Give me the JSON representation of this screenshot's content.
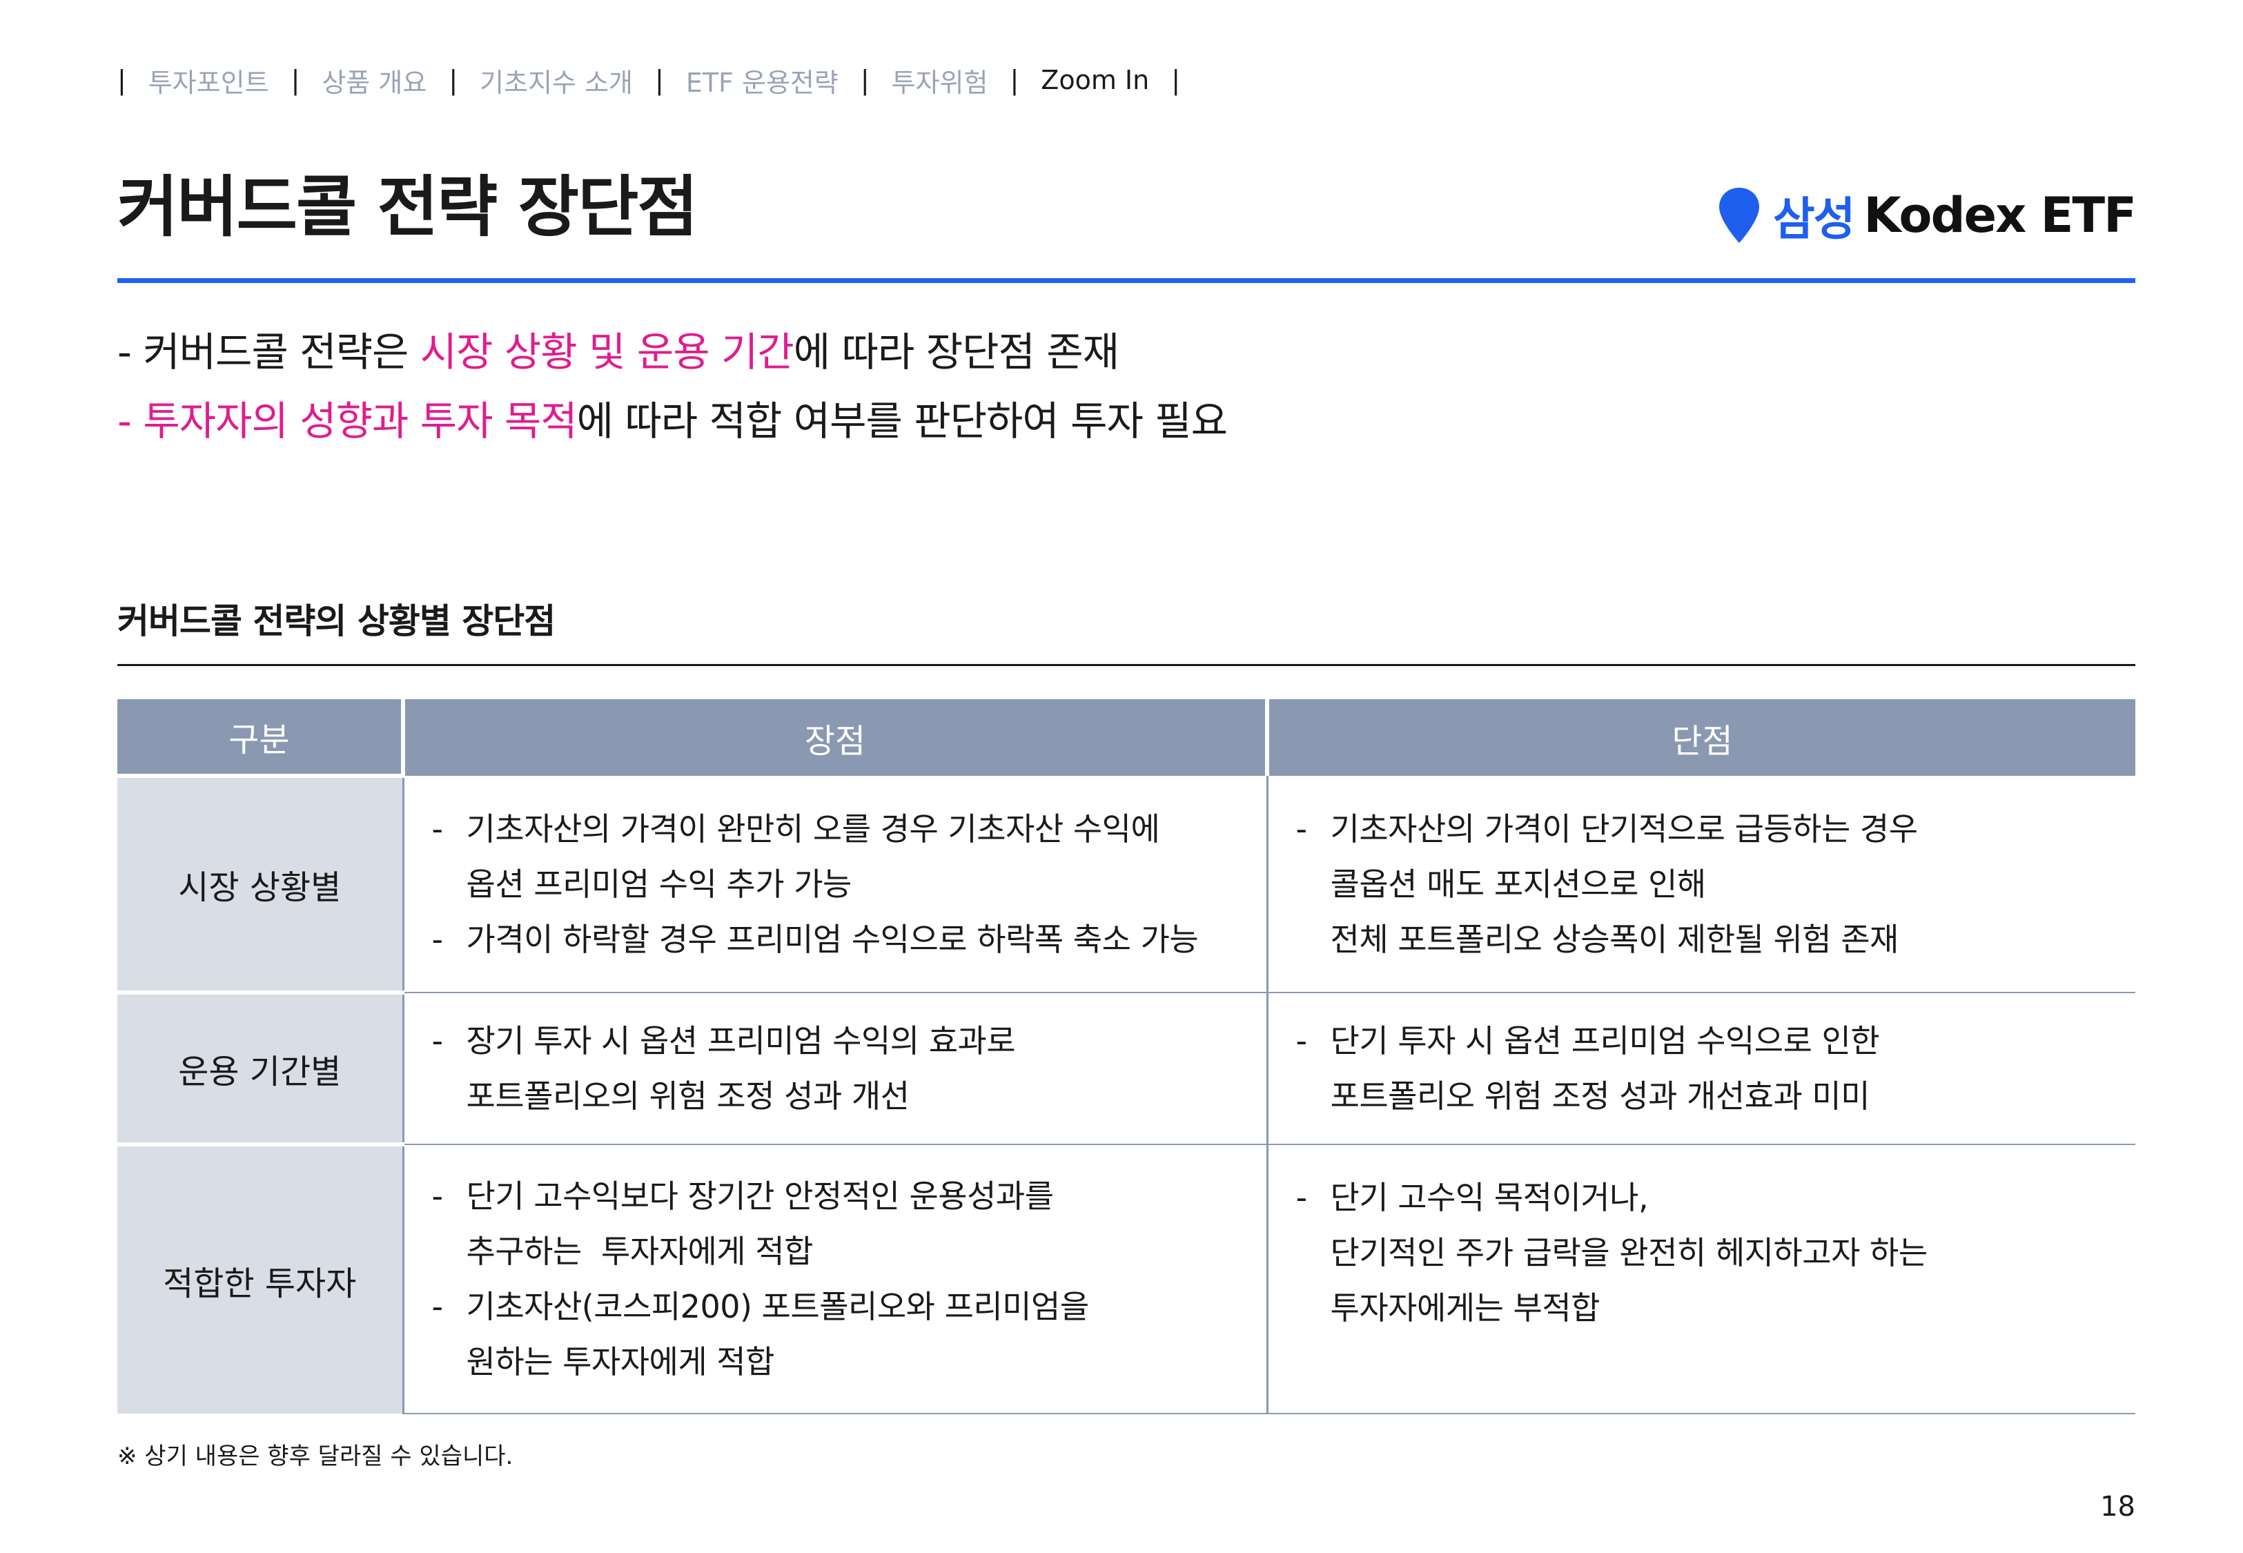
{
  "nav": {
    "items": [
      "투자포인트",
      "상품 개요",
      "기초지수 소개",
      "ETF 운용전략",
      "투자위험",
      "Zoom In"
    ],
    "active": "Zoom In"
  },
  "title": "커버드콜 전략 장단점",
  "logo": {
    "brand_ko": "삼성",
    "brand_en": "Kodex ETF",
    "color": "#1e5ff0"
  },
  "bullets": [
    {
      "prefix": "- 커버드콜 전략은 ",
      "highlight": "시장 상황 및 운용 기간",
      "suffix": "에 따라 장단점 존재"
    },
    {
      "prefix": "",
      "highlight": "- 투자자의 성향과 투자 목적",
      "suffix": "에 따라 적합 여부를 판단하여 투자 필요"
    }
  ],
  "highlight_color": "#e01c8f",
  "section_title": "커버드콜 전략의 상황별 장단점",
  "table": {
    "headers": [
      "구분",
      "장점",
      "단점"
    ],
    "rows": [
      {
        "category": "시장 상황별",
        "pros": [
          "기초자산의 가격이 완만히 오를 경우 기초자산 수익에\n옵션 프리미엄 수익 추가 가능",
          "가격이 하락할 경우 프리미엄 수익으로 하락폭 축소 가능"
        ],
        "cons": [
          "기초자산의 가격이 단기적으로 급등하는 경우\n콜옵션 매도 포지션으로 인해\n전체 포트폴리오 상승폭이 제한될 위험 존재"
        ]
      },
      {
        "category": "운용 기간별",
        "pros": [
          "장기 투자 시 옵션 프리미엄 수익의 효과로\n포트폴리오의 위험 조정 성과 개선"
        ],
        "cons": [
          "단기 투자 시 옵션 프리미엄 수익으로 인한\n포트폴리오 위험 조정 성과 개선효과 미미"
        ]
      },
      {
        "category": "적합한 투자자",
        "pros": [
          "단기 고수익보다 장기간 안정적인 운용성과를\n추구하는  투자자에게 적합",
          "기초자산(코스피200) 포트폴리오와 프리미엄을\n원하는 투자자에게 적합"
        ],
        "cons": [
          "단기 고수익 목적이거나,\n단기적인 주가 급락을 완전히 헤지하고자 하는\n투자자에게는 부적합"
        ]
      }
    ]
  },
  "footnote": "※ 상기 내용은 향후 달라질 수 있습니다.",
  "page_number": "18"
}
